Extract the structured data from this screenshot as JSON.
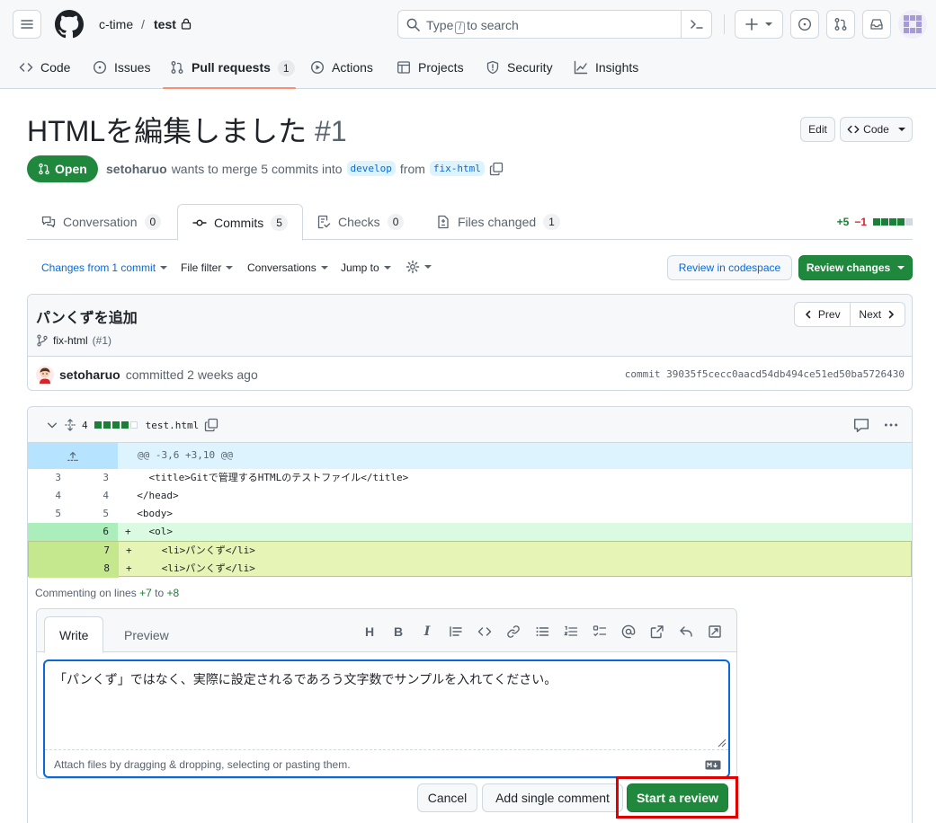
{
  "header": {
    "owner": "c-time",
    "separator": "/",
    "repo": "test",
    "search_placeholder": "Type / to search",
    "search_prefix": "Type",
    "search_key": "/",
    "search_suffix": "to search"
  },
  "repo_nav": [
    {
      "label": "Code",
      "icon": "code-icon"
    },
    {
      "label": "Issues",
      "icon": "issue-opened-icon"
    },
    {
      "label": "Pull requests",
      "icon": "git-pull-request-icon",
      "count": "1",
      "active": true
    },
    {
      "label": "Actions",
      "icon": "play-icon"
    },
    {
      "label": "Projects",
      "icon": "table-icon"
    },
    {
      "label": "Security",
      "icon": "shield-icon"
    },
    {
      "label": "Insights",
      "icon": "graph-icon"
    }
  ],
  "pr": {
    "title": "HTMLを編集しました",
    "number": "#1",
    "edit_label": "Edit",
    "code_label": "Code",
    "state": "Open",
    "author": "setoharuo",
    "merge_text": "wants to merge 5 commits into",
    "base_branch": "develop",
    "from_text": "from",
    "head_branch": "fix-html"
  },
  "tabs": [
    {
      "label": "Conversation",
      "count": "0"
    },
    {
      "label": "Commits",
      "count": "5",
      "selected": true
    },
    {
      "label": "Checks",
      "count": "0"
    },
    {
      "label": "Files changed",
      "count": "1"
    }
  ],
  "diffstat": {
    "additions": "+5",
    "deletions": "−1"
  },
  "toolbar": {
    "changes_prefix": "Changes from",
    "changes_link": "1 commit",
    "file_filter": "File filter",
    "conversations": "Conversations",
    "jump_to": "Jump to",
    "review_codespace": "Review in codespace",
    "review_changes": "Review changes"
  },
  "commit": {
    "message": "パンくずを追加",
    "branch": "fix-html",
    "pr_ref": "(#1)",
    "prev_label": "Prev",
    "next_label": "Next",
    "author": "setoharuo",
    "committed_text": "committed 2 weeks ago",
    "sha_label": "commit 39035f5cecc0aacd54db494ce51ed50ba5726430"
  },
  "file": {
    "change_count": "4",
    "filename": "test.html",
    "hunk_header": "@@ -3,6 +3,10 @@",
    "lines": [
      {
        "old": "3",
        "new": "3",
        "sign": " ",
        "code": "  <title>Gitで管理するHTMLのテストファイル</title>",
        "type": "context"
      },
      {
        "old": "4",
        "new": "4",
        "sign": " ",
        "code": "</head>",
        "type": "context"
      },
      {
        "old": "5",
        "new": "5",
        "sign": " ",
        "code": "<body>",
        "type": "context"
      },
      {
        "old": "",
        "new": "6",
        "sign": "+",
        "code": "  <ol>",
        "type": "add"
      },
      {
        "old": "",
        "new": "7",
        "sign": "+",
        "code": "    <li>パンくず</li>",
        "type": "selected"
      },
      {
        "old": "",
        "new": "8",
        "sign": "+",
        "code": "    <li>パンくず</li>",
        "type": "selected"
      }
    ]
  },
  "comment": {
    "label_prefix": "Commenting on lines",
    "from_line": "+7",
    "to_text": "to",
    "to_line": "+8",
    "write_tab": "Write",
    "preview_tab": "Preview",
    "body": "「パンくず」ではなく、実際に設定されるであろう文字数でサンプルを入れてください。",
    "attach_hint": "Attach files by dragging & dropping, selecting or pasting them.",
    "cancel": "Cancel",
    "add_single": "Add single comment",
    "start_review": "Start a review"
  },
  "colors": {
    "accent": "#0969da",
    "success": "#1f883d",
    "danger": "#d1242f",
    "highlight": "#e00000"
  }
}
